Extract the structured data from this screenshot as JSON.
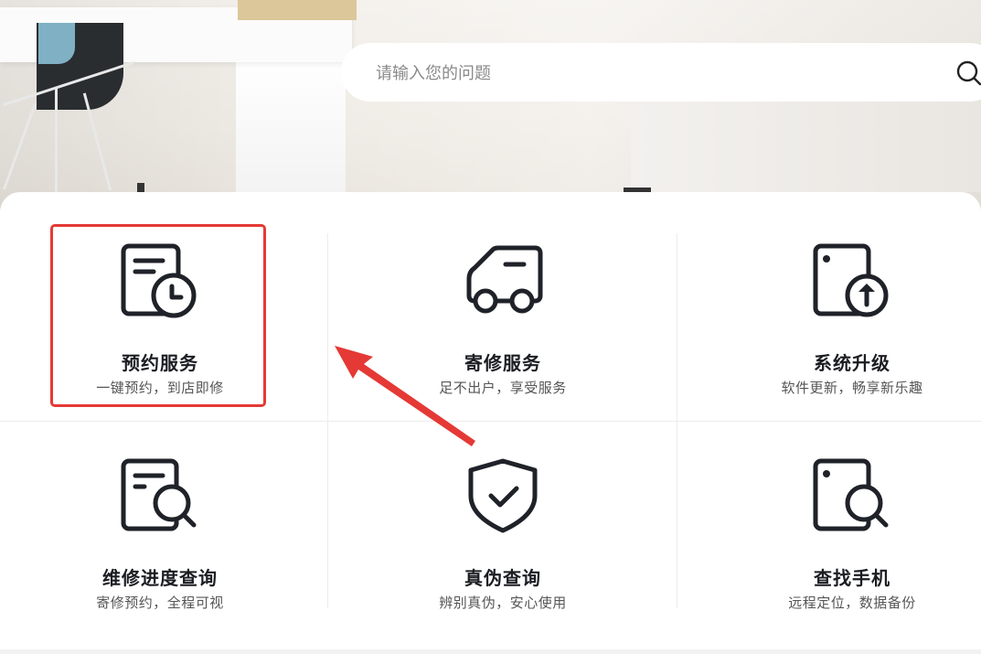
{
  "search": {
    "placeholder": "请输入您的问题",
    "value": ""
  },
  "services": [
    {
      "title": "预约服务",
      "subtitle": "一键预约，到店即修",
      "icon": "appointment-clock-icon"
    },
    {
      "title": "寄修服务",
      "subtitle": "足不出户，享受服务",
      "icon": "car-icon"
    },
    {
      "title": "系统升级",
      "subtitle": "软件更新，畅享新乐趣",
      "icon": "phone-upgrade-icon"
    },
    {
      "title": "维修进度查询",
      "subtitle": "寄修预约，全程可视",
      "icon": "document-search-icon"
    },
    {
      "title": "真伪查询",
      "subtitle": "辨别真伪，安心使用",
      "icon": "shield-check-icon"
    },
    {
      "title": "查找手机",
      "subtitle": "远程定位，数据备份",
      "icon": "phone-search-icon"
    }
  ],
  "colors": {
    "icon_stroke": "#1f2228",
    "highlight": "#e53935"
  }
}
